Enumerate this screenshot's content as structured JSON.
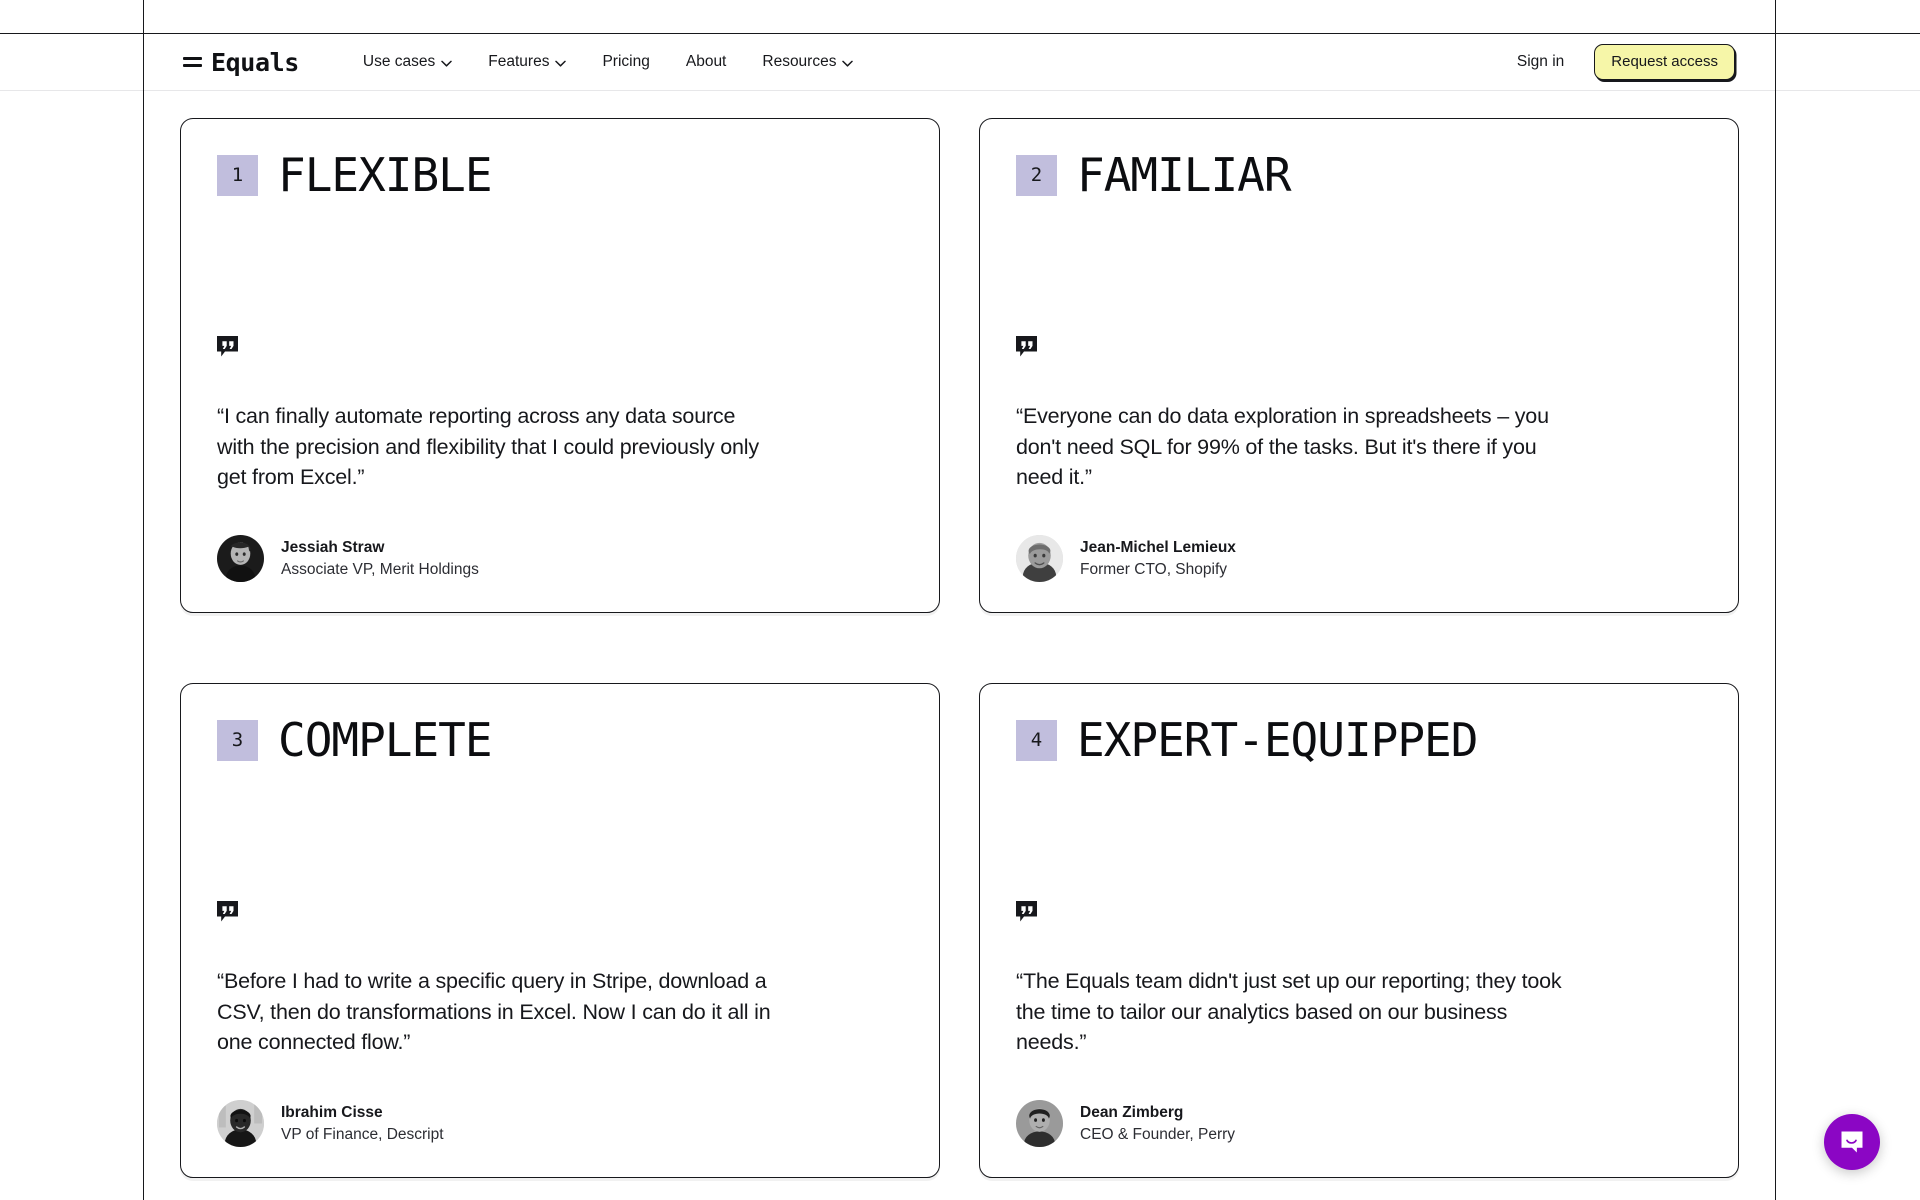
{
  "header": {
    "logo_text": "Equals",
    "logo_icon": "equals-mark",
    "nav": [
      {
        "label": "Use cases",
        "has_dropdown": true
      },
      {
        "label": "Features",
        "has_dropdown": true
      },
      {
        "label": "Pricing",
        "has_dropdown": false
      },
      {
        "label": "About",
        "has_dropdown": false
      },
      {
        "label": "Resources",
        "has_dropdown": true
      }
    ],
    "sign_in_label": "Sign in",
    "request_access_label": "Request access",
    "request_access_bg": "#f6f6a8"
  },
  "colors": {
    "badge_lavender": "#c1bedd",
    "ink": "#17181c",
    "chat_purple": "#8b06c4"
  },
  "cards": [
    {
      "number": "1",
      "title": "FLEXIBLE",
      "quote": "“I can finally automate reporting across any data source with the precision and flexibility that I could previously only get from Excel.”",
      "name": "Jessiah Straw",
      "role": "Associate VP, Merit Holdings",
      "avatar": "portrait-jessiah-straw"
    },
    {
      "number": "2",
      "title": "FAMILIAR",
      "quote": "“Everyone can do data exploration in spreadsheets – you don't need SQL for 99% of the tasks. But it's there if you need it.”",
      "name": "Jean-Michel Lemieux",
      "role": "Former CTO, Shopify",
      "avatar": "portrait-jean-michel-lemieux"
    },
    {
      "number": "3",
      "title": "COMPLETE",
      "quote": "“Before I had to write a specific query in Stripe, download a CSV, then do transformations in Excel. Now I can do it all in one connected flow.”",
      "name": "Ibrahim Cisse",
      "role": "VP of Finance, Descript",
      "avatar": "portrait-ibrahim-cisse"
    },
    {
      "number": "4",
      "title": "EXPERT-EQUIPPED",
      "quote": "“The Equals team didn't just set up our reporting; they took the time to tailor our analytics based on our business needs.”",
      "name": "Dean Zimberg",
      "role": "CEO & Founder, Perry",
      "avatar": "portrait-dean-zimberg"
    }
  ],
  "chat": {
    "icon": "chat-bubble-smile-icon"
  }
}
